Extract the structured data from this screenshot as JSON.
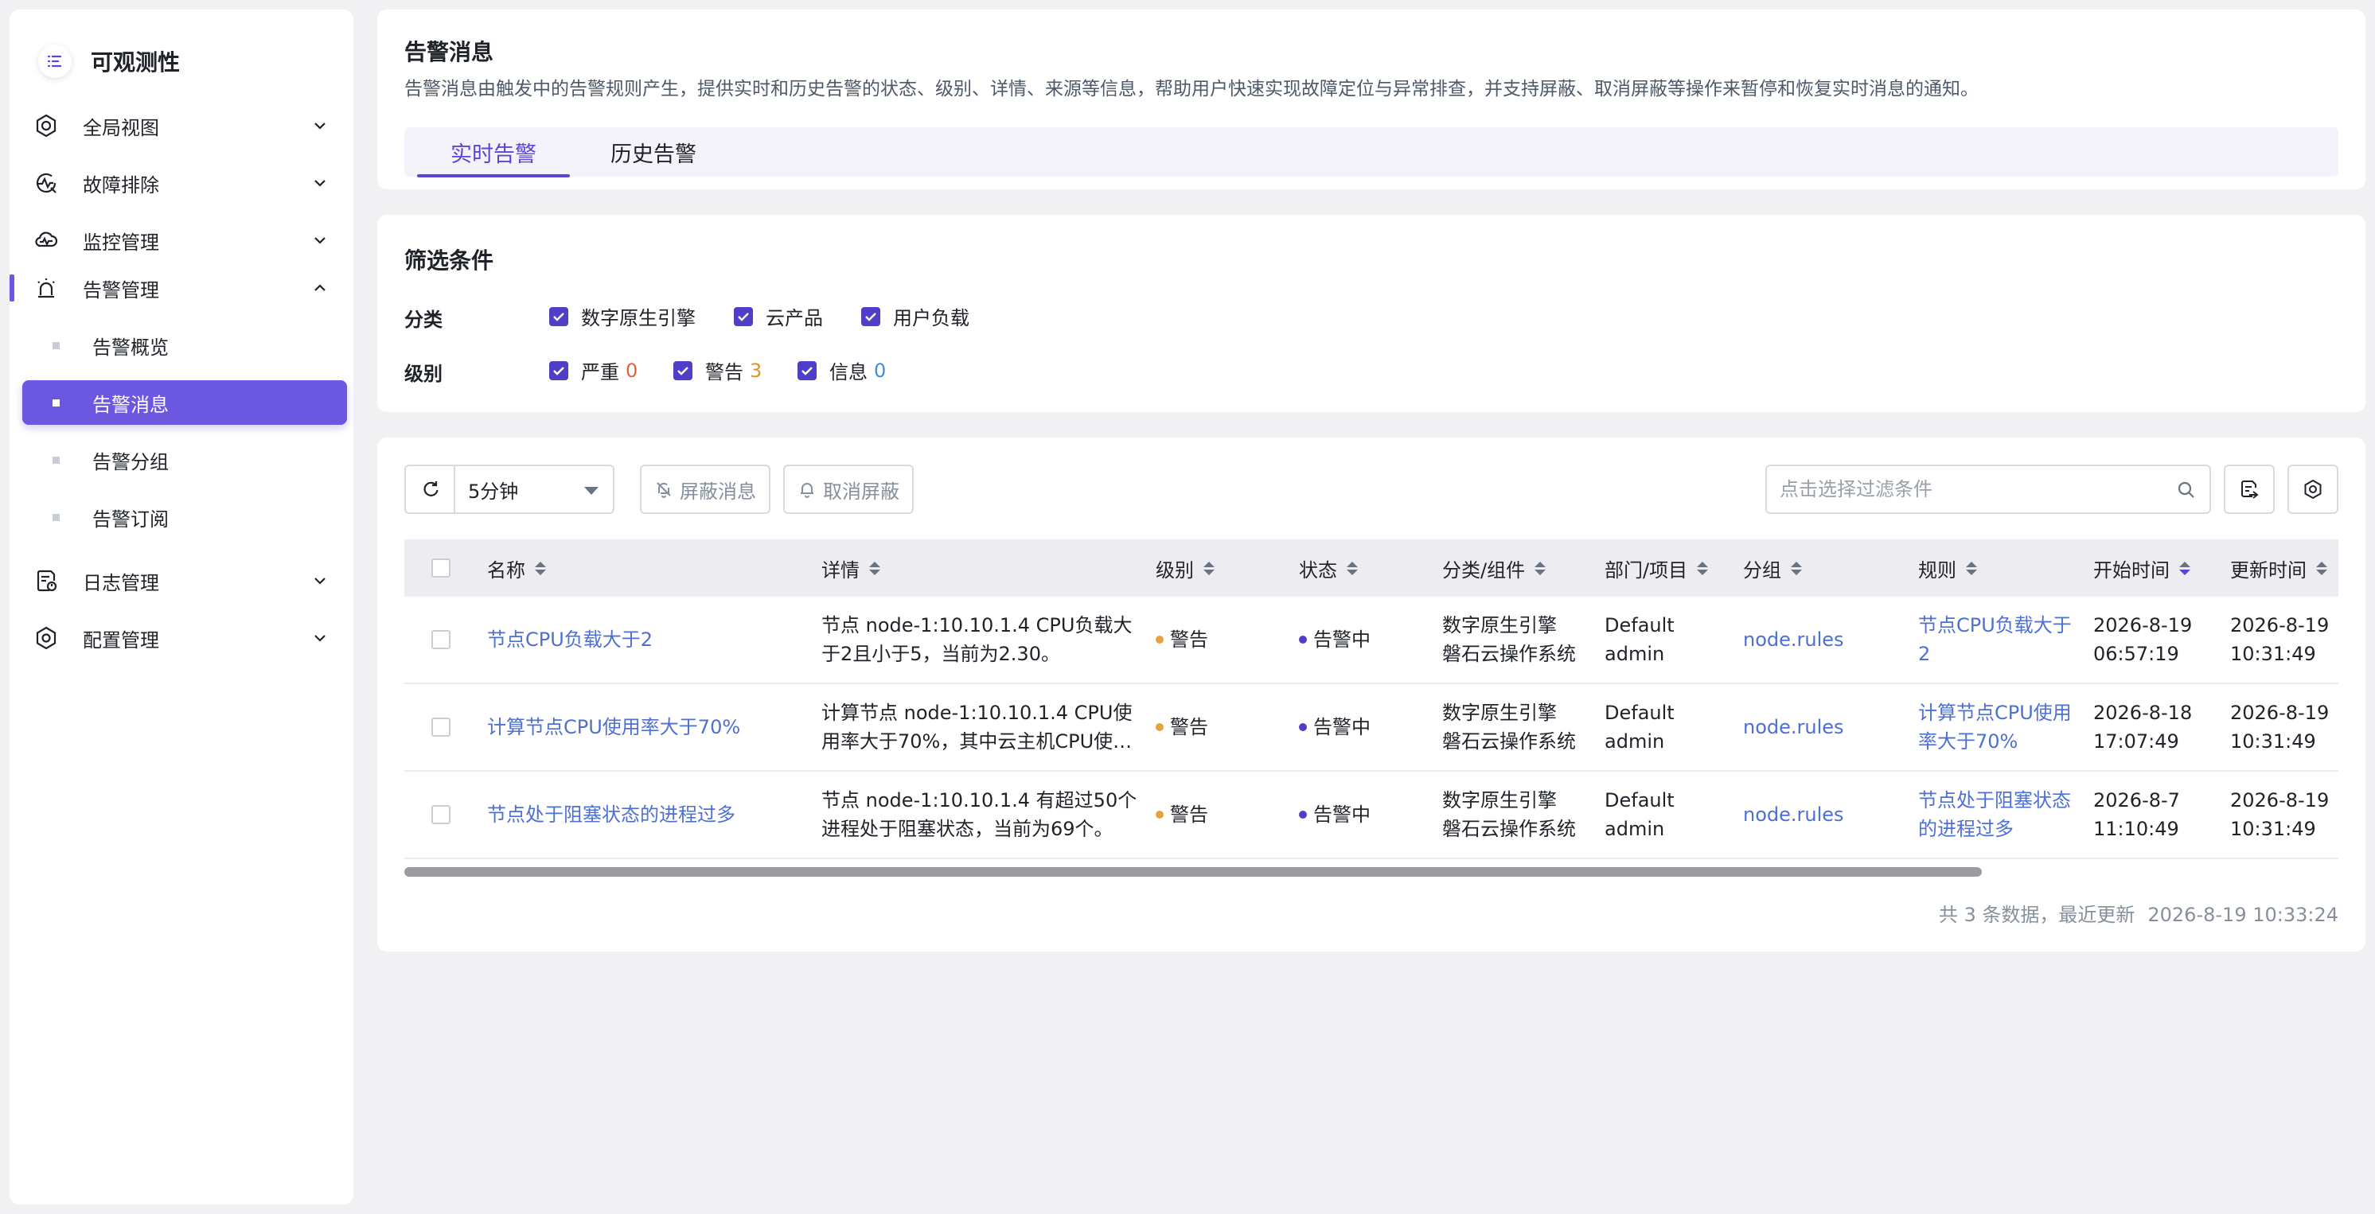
{
  "sidebar": {
    "brand": "可观测性",
    "items": [
      {
        "label": "全局视图"
      },
      {
        "label": "故障排除"
      },
      {
        "label": "监控管理"
      },
      {
        "label": "告警管理"
      },
      {
        "label": "日志管理"
      },
      {
        "label": "配置管理"
      }
    ],
    "sub_items": [
      {
        "label": "告警概览"
      },
      {
        "label": "告警消息"
      },
      {
        "label": "告警分组"
      },
      {
        "label": "告警订阅"
      }
    ]
  },
  "header": {
    "title": "告警消息",
    "description": "告警消息由触发中的告警规则产生，提供实时和历史告警的状态、级别、详情、来源等信息，帮助用户快速实现故障定位与异常排查，并支持屏蔽、取消屏蔽等操作来暂停和恢复实时消息的通知。",
    "tabs": [
      {
        "label": "实时告警"
      },
      {
        "label": "历史告警"
      }
    ]
  },
  "filters": {
    "title": "筛选条件",
    "category_label": "分类",
    "categories": [
      "数字原生引擎",
      "云产品",
      "用户负载"
    ],
    "level_label": "级别",
    "levels": [
      {
        "label": "严重",
        "count": "0"
      },
      {
        "label": "警告",
        "count": "3"
      },
      {
        "label": "信息",
        "count": "0"
      }
    ]
  },
  "toolbar": {
    "interval": "5分钟",
    "mute_label": "屏蔽消息",
    "unmute_label": "取消屏蔽",
    "search_placeholder": "点击选择过滤条件"
  },
  "table": {
    "columns": [
      "名称",
      "详情",
      "级别",
      "状态",
      "分类/组件",
      "部门/项目",
      "分组",
      "规则",
      "开始时间",
      "更新时间"
    ],
    "rows": [
      {
        "name": "节点CPU负载大于2",
        "detail": "节点 node-1:10.10.1.4 CPU负载大于2且小于5，当前为2.30。",
        "level": "警告",
        "state": "告警中",
        "category_1": "数字原生引擎",
        "category_2": "磐石云操作系统",
        "dept_1": "Default",
        "dept_2": "admin",
        "group": "node.rules",
        "rule": "节点CPU负载大于2",
        "start_1": "2026-8-19",
        "start_2": "06:57:19",
        "update_1": "2026-8-19",
        "update_2": "10:31:49"
      },
      {
        "name": "计算节点CPU使用率大于70%",
        "detail": "计算节点 node-1:10.10.1.4 CPU使用率大于70%，其中云主机CPU使…",
        "level": "警告",
        "state": "告警中",
        "category_1": "数字原生引擎",
        "category_2": "磐石云操作系统",
        "dept_1": "Default",
        "dept_2": "admin",
        "group": "node.rules",
        "rule": "计算节点CPU使用率大于70%",
        "start_1": "2026-8-18",
        "start_2": "17:07:49",
        "update_1": "2026-8-19",
        "update_2": "10:31:49"
      },
      {
        "name": "节点处于阻塞状态的进程过多",
        "detail": "节点 node-1:10.10.1.4 有超过50个进程处于阻塞状态，当前为69个。",
        "level": "警告",
        "state": "告警中",
        "category_1": "数字原生引擎",
        "category_2": "磐石云操作系统",
        "dept_1": "Default",
        "dept_2": "admin",
        "group": "node.rules",
        "rule": "节点处于阻塞状态的进程过多",
        "start_1": "2026-8-7",
        "start_2": "11:10:49",
        "update_1": "2026-8-19",
        "update_2": "10:31:49"
      }
    ],
    "footer_count": "共 3 条数据，最近更新",
    "footer_time": "2026-8-19 10:33:24"
  },
  "colors": {
    "accent": "#6b57e0",
    "link": "#4e6fd3",
    "warning": "#e6a23c"
  }
}
